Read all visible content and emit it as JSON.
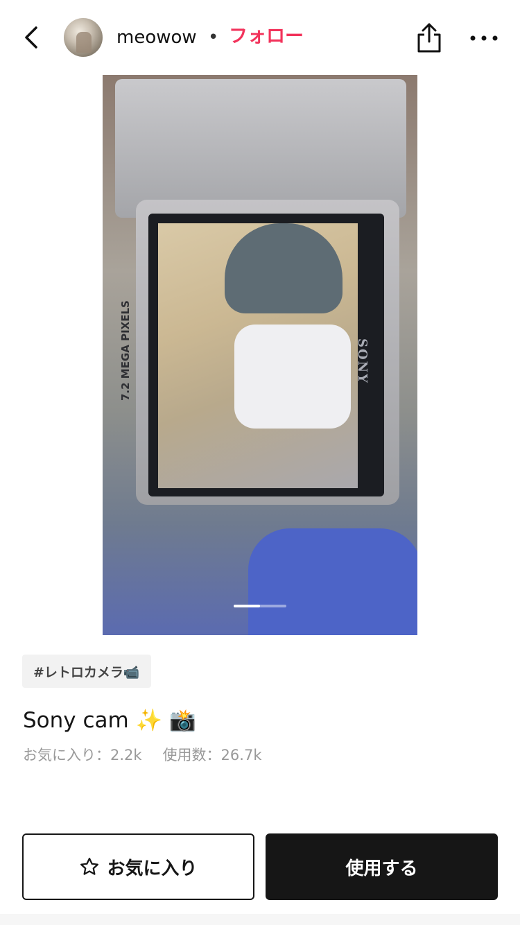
{
  "header": {
    "username": "meowow",
    "separator": "•",
    "follow_label": "フォロー",
    "follow_color": "#f2335b"
  },
  "icons": {
    "back": "chevron-left-icon",
    "share": "share-icon",
    "more": "more-horizontal-icon",
    "favorite": "star-outline-icon"
  },
  "photo": {
    "camera_text": "7.2 MEGA PIXELS",
    "brand_text": "SONY",
    "pager": {
      "current": 1,
      "total": 2
    }
  },
  "tag": "#レトロカメラ📹",
  "title": "Sony cam ✨ 📸",
  "stats": {
    "favorites": "お気に入り：2.2k",
    "uses": "使用数：26.7k"
  },
  "buttons": {
    "favorite_label": "お気に入り",
    "use_label": "使用する"
  }
}
